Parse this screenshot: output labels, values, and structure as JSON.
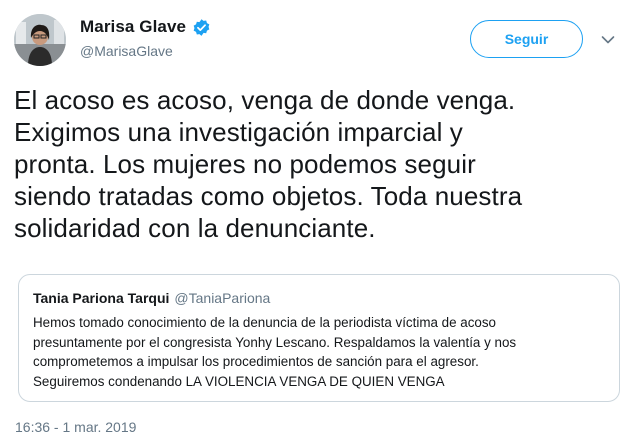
{
  "author": {
    "display_name": "Marisa Glave",
    "handle": "@MarisaGlave",
    "verified": true
  },
  "follow_button": {
    "label": "Seguir"
  },
  "tweet": {
    "text_lines": [
      "El acoso es acoso, venga de donde venga.",
      "Exigimos una investigación imparcial y",
      "pronta. Los mujeres no podemos seguir",
      "siendo tratadas como objetos. Toda nuestra",
      "solidaridad con la denunciante."
    ],
    "timestamp": "16:36 - 1 mar. 2019"
  },
  "quoted_tweet": {
    "display_name": "Tania Pariona Tarqui",
    "handle": "@TaniaPariona",
    "text_lines": [
      "Hemos tomado conocimiento de la denuncia de la periodista víctima de acoso",
      "presuntamente por el congresista Yonhy Lescano. Respaldamos la valentía y nos",
      "comprometemos a impulsar los procedimientos de sanción para el agresor.",
      "Seguiremos condenando LA VIOLENCIA VENGA DE QUIEN VENGA"
    ]
  },
  "colors": {
    "accent": "#1da1f2",
    "text": "#14171a",
    "muted": "#657786",
    "border": "#ccd6dd"
  },
  "icons": {
    "verified": "verified-badge-icon",
    "more": "chevron-down-icon"
  }
}
